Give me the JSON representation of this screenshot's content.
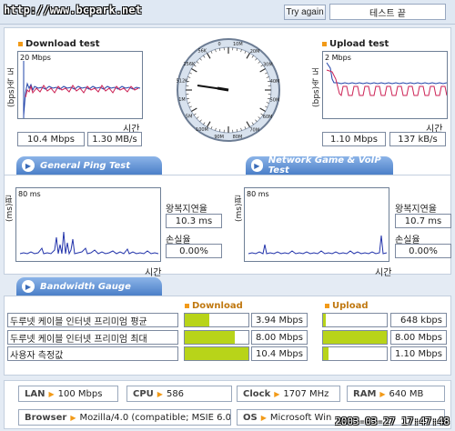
{
  "watermark": "http://www.bcpark.net",
  "top": {
    "try_again": "Try again",
    "test_field": "테스트 끝"
  },
  "download": {
    "title": "Download test",
    "unit": "(bps)속 도",
    "scale": "20 Mbps",
    "xlabel": "시간",
    "mbps": "10.4 Mbps",
    "mbs": "1.30 MB/s"
  },
  "upload": {
    "title": "Upload test",
    "unit": "(bps)속 도",
    "scale": "2 Mbps",
    "xlabel": "시간",
    "mbps": "1.10 Mbps",
    "kbs": "137 kB/s"
  },
  "gauge": {
    "labels": [
      "10M",
      "20M",
      "30M",
      "40M",
      "50M",
      "60M",
      "70M",
      "80M",
      "90M",
      "100M",
      "5M",
      "1M",
      "512K",
      "256K",
      "56K",
      "0"
    ]
  },
  "tabs": {
    "ping": "General Ping Test",
    "game": "Network Game & VoIP Test",
    "bandwidth": "Bandwidth Gauge"
  },
  "ping_left": {
    "unit": "(ms)편",
    "scale": "80 ms",
    "xlabel": "시간",
    "rtt_label": "왕복지연율",
    "rtt_value": "10.3 ms",
    "loss_label": "손실율",
    "loss_value": "0.00%"
  },
  "ping_right": {
    "unit": "(ms)편",
    "scale": "80 ms",
    "xlabel": "시간",
    "rtt_label": "왕복지연율",
    "rtt_value": "10.7 ms",
    "loss_label": "손실율",
    "loss_value": "0.00%"
  },
  "bandwidth": {
    "download_head": "Download",
    "upload_head": "Upload",
    "rows": [
      {
        "label": "두루넷 케이블 인터넷 프리미엄 평균",
        "down": "3.94 Mbps",
        "down_fill": 0.39,
        "up": "648 kbps",
        "up_fill": 0.04
      },
      {
        "label": "두루넷 케이블 인터넷 프리미엄 최대",
        "down": "8.00 Mbps",
        "down_fill": 0.78,
        "up": "8.00 Mbps",
        "up_fill": 1.0
      },
      {
        "label": "사용자 측정값",
        "down": "10.4 Mbps",
        "down_fill": 1.0,
        "up": "1.10 Mbps",
        "up_fill": 0.09
      }
    ]
  },
  "info": {
    "lan_key": "LAN",
    "lan_val": "100 Mbps",
    "cpu_key": "CPU",
    "cpu_val": "586",
    "clock_key": "Clock",
    "clock_val": "1707 MHz",
    "ram_key": "RAM",
    "ram_val": "640 MB",
    "browser_key": "Browser",
    "browser_val": "Mozilla/4.0 (compatible; MSIE 6.0",
    "os_key": "OS",
    "os_val": "Microsoft Win"
  },
  "timestamp": "2003-03-27 17:47:48",
  "colors": {
    "accent": "#f29a18",
    "tab": "#4b7fc8",
    "bar": "#b8d419",
    "download_line": "#cc2255",
    "upload_line": "#cc2255"
  }
}
